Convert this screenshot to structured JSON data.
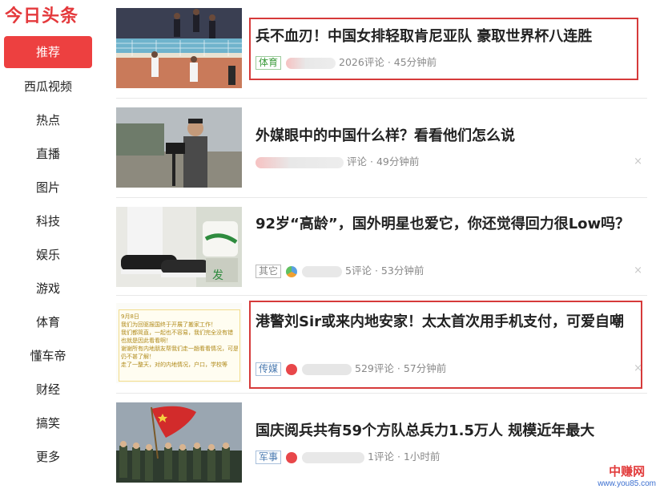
{
  "app": {
    "logo": "今日头条"
  },
  "nav": [
    {
      "label": "推荐",
      "active": true
    },
    {
      "label": "西瓜视频"
    },
    {
      "label": "热点"
    },
    {
      "label": "直播"
    },
    {
      "label": "图片"
    },
    {
      "label": "科技"
    },
    {
      "label": "娱乐"
    },
    {
      "label": "游戏"
    },
    {
      "label": "体育"
    },
    {
      "label": "懂车帝"
    },
    {
      "label": "财经"
    },
    {
      "label": "搞笑"
    },
    {
      "label": "更多"
    }
  ],
  "articles": [
    {
      "title": "兵不血刃！中国女排轻取肯尼亚队 豪取世界杯八连胜",
      "tag": "体育",
      "comments": "2026评论",
      "time": "45分钟前",
      "thumb_icon": "volleyball-photo"
    },
    {
      "title": "外媒眼中的中国什么样？看看他们怎么说",
      "tag": "",
      "comments": "评论",
      "time": "49分钟前",
      "thumb_icon": "camera-man-photo"
    },
    {
      "title": "92岁“高龄”，国外明星也爱它，你还觉得回力很Low吗？",
      "tag": "其它",
      "comments": "5评论",
      "time": "53分钟前",
      "thumb_icon": "sneakers-photo"
    },
    {
      "title": "港警刘Sir或来内地安家！太太首次用手机支付，可爱自嘲",
      "tag": "传媒",
      "comments": "529评论",
      "time": "57分钟前",
      "thumb_icon": "chat-screenshot"
    },
    {
      "title": "国庆阅兵共有59个方队总兵力1.5万人 规模近年最大",
      "tag": "军事",
      "comments": "1评论",
      "time": "1小时前",
      "thumb_icon": "parade-photo"
    }
  ],
  "sep": "·",
  "close_glyph": "×",
  "thumb_text": {
    "chat_date": "9月8日",
    "chat_lines": [
      "我们为回驱报国终于开展了搬家工作！",
      "我们都简直，一起也不容易，我们完全没有错",
      "也就是因此看看啊！",
      "谢谢所有内地朋友帮我们走一趟看看情况，可是",
      "仍不甚了解！",
      "走了一整天，对的内地情况，户口，学校等"
    ],
    "shoe_marks": [
      "发"
    ]
  },
  "watermark": {
    "cn": "中赚网",
    "url": "www.you85.com"
  },
  "colors": {
    "accent": "#ed4040",
    "highlight": "#d63a3a"
  }
}
